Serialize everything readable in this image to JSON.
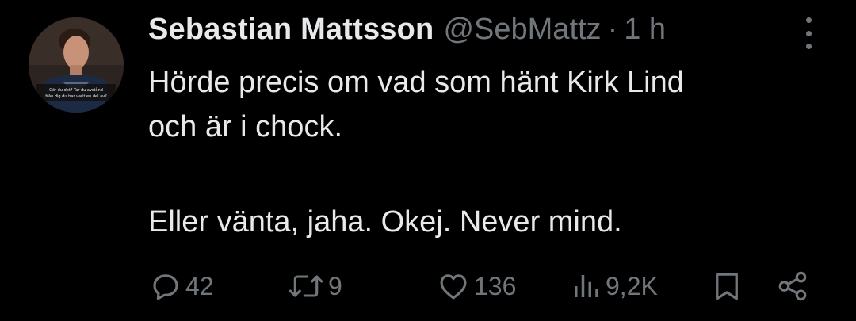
{
  "tweet": {
    "author": {
      "display_name": "Sebastian Mattsson",
      "handle": "@SebMattz",
      "separator": "·",
      "time": "1 h",
      "avatar_caption_line1": "Gör du det? Tar du avstånd",
      "avatar_caption_line2": "från dig du har varit en del av?"
    },
    "text": {
      "line1": "Hörde precis om vad som hänt Kirk Lind",
      "line2": "och är i chock.",
      "line3": "Eller vänta, jaha. Okej. Never mind."
    },
    "actions": {
      "replies": "42",
      "retweets": "9",
      "likes": "136",
      "views": "9,2K"
    },
    "icons": {
      "more": "more-vertical-icon",
      "reply": "reply-icon",
      "retweet": "retweet-icon",
      "like": "heart-icon",
      "views": "views-icon",
      "bookmark": "bookmark-icon",
      "share": "share-icon"
    },
    "colors": {
      "background": "#000000",
      "text_primary": "#e7e9ea",
      "text_secondary": "#71767b"
    }
  }
}
